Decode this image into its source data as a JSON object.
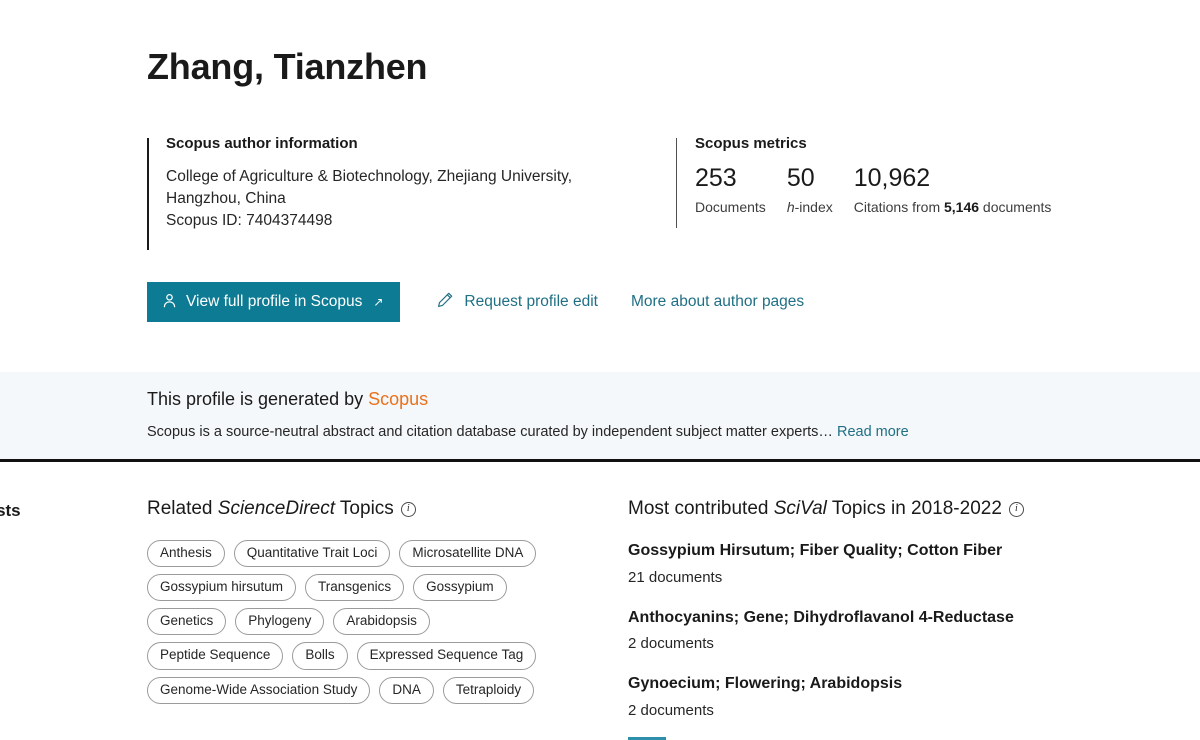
{
  "header": {
    "author_name": "Zhang, Tianzhen",
    "author_info": {
      "title": "Scopus author information",
      "affiliation": "College of Agriculture & Biotechnology, Zhejiang University, Hangzhou, China",
      "scopus_id": "Scopus ID: 7404374498"
    },
    "metrics": {
      "title": "Scopus metrics",
      "documents": {
        "value": "253",
        "label": "Documents"
      },
      "h_index": {
        "value": "50",
        "label_italic": "h",
        "label_rest": "-index"
      },
      "citations": {
        "value": "10,962",
        "label_prefix": "Citations from ",
        "label_count": "5,146",
        "label_suffix": " documents"
      }
    }
  },
  "actions": {
    "primary_button": "View full profile in Scopus",
    "primary_button_arrow": "↗",
    "request_edit": "Request profile edit",
    "more_about": "More about author pages"
  },
  "notice": {
    "title_prefix": "This profile is generated by ",
    "title_brand": "Scopus",
    "body": "Scopus is a source-neutral abstract and citation database curated by independent subject matter experts… ",
    "read_more": "Read more"
  },
  "topics": {
    "cut_off_label": "rests",
    "sciencedirect": {
      "heading_prefix": "Related ",
      "heading_italic": "ScienceDirect",
      "heading_suffix": " Topics",
      "info_glyph": "i",
      "pills": [
        "Anthesis",
        "Quantitative Trait Loci",
        "Microsatellite DNA",
        "Gossypium hirsutum",
        "Transgenics",
        "Gossypium",
        "Genetics",
        "Phylogeny",
        "Arabidopsis",
        "Peptide Sequence",
        "Bolls",
        "Expressed Sequence Tag",
        "Genome-Wide Association Study",
        "DNA",
        "Tetraploidy"
      ]
    },
    "scival": {
      "heading_prefix": "Most contributed ",
      "heading_italic": "SciVal",
      "heading_suffix": " Topics in 2018-2022",
      "info_glyph": "i",
      "items": [
        {
          "title": "Gossypium Hirsutum; Fiber Quality; Cotton Fiber",
          "count": "21 documents"
        },
        {
          "title": "Anthocyanins; Gene; Dihydroflavanol 4-Reductase",
          "count": "2 documents"
        },
        {
          "title": "Gynoecium; Flowering; Arabidopsis",
          "count": "2 documents"
        }
      ]
    }
  },
  "colors": {
    "brand_teal": "#0c7b93",
    "link_teal": "#1f6f85",
    "scopus_orange": "#e9711c",
    "banner_bg": "#f5f8fa"
  }
}
